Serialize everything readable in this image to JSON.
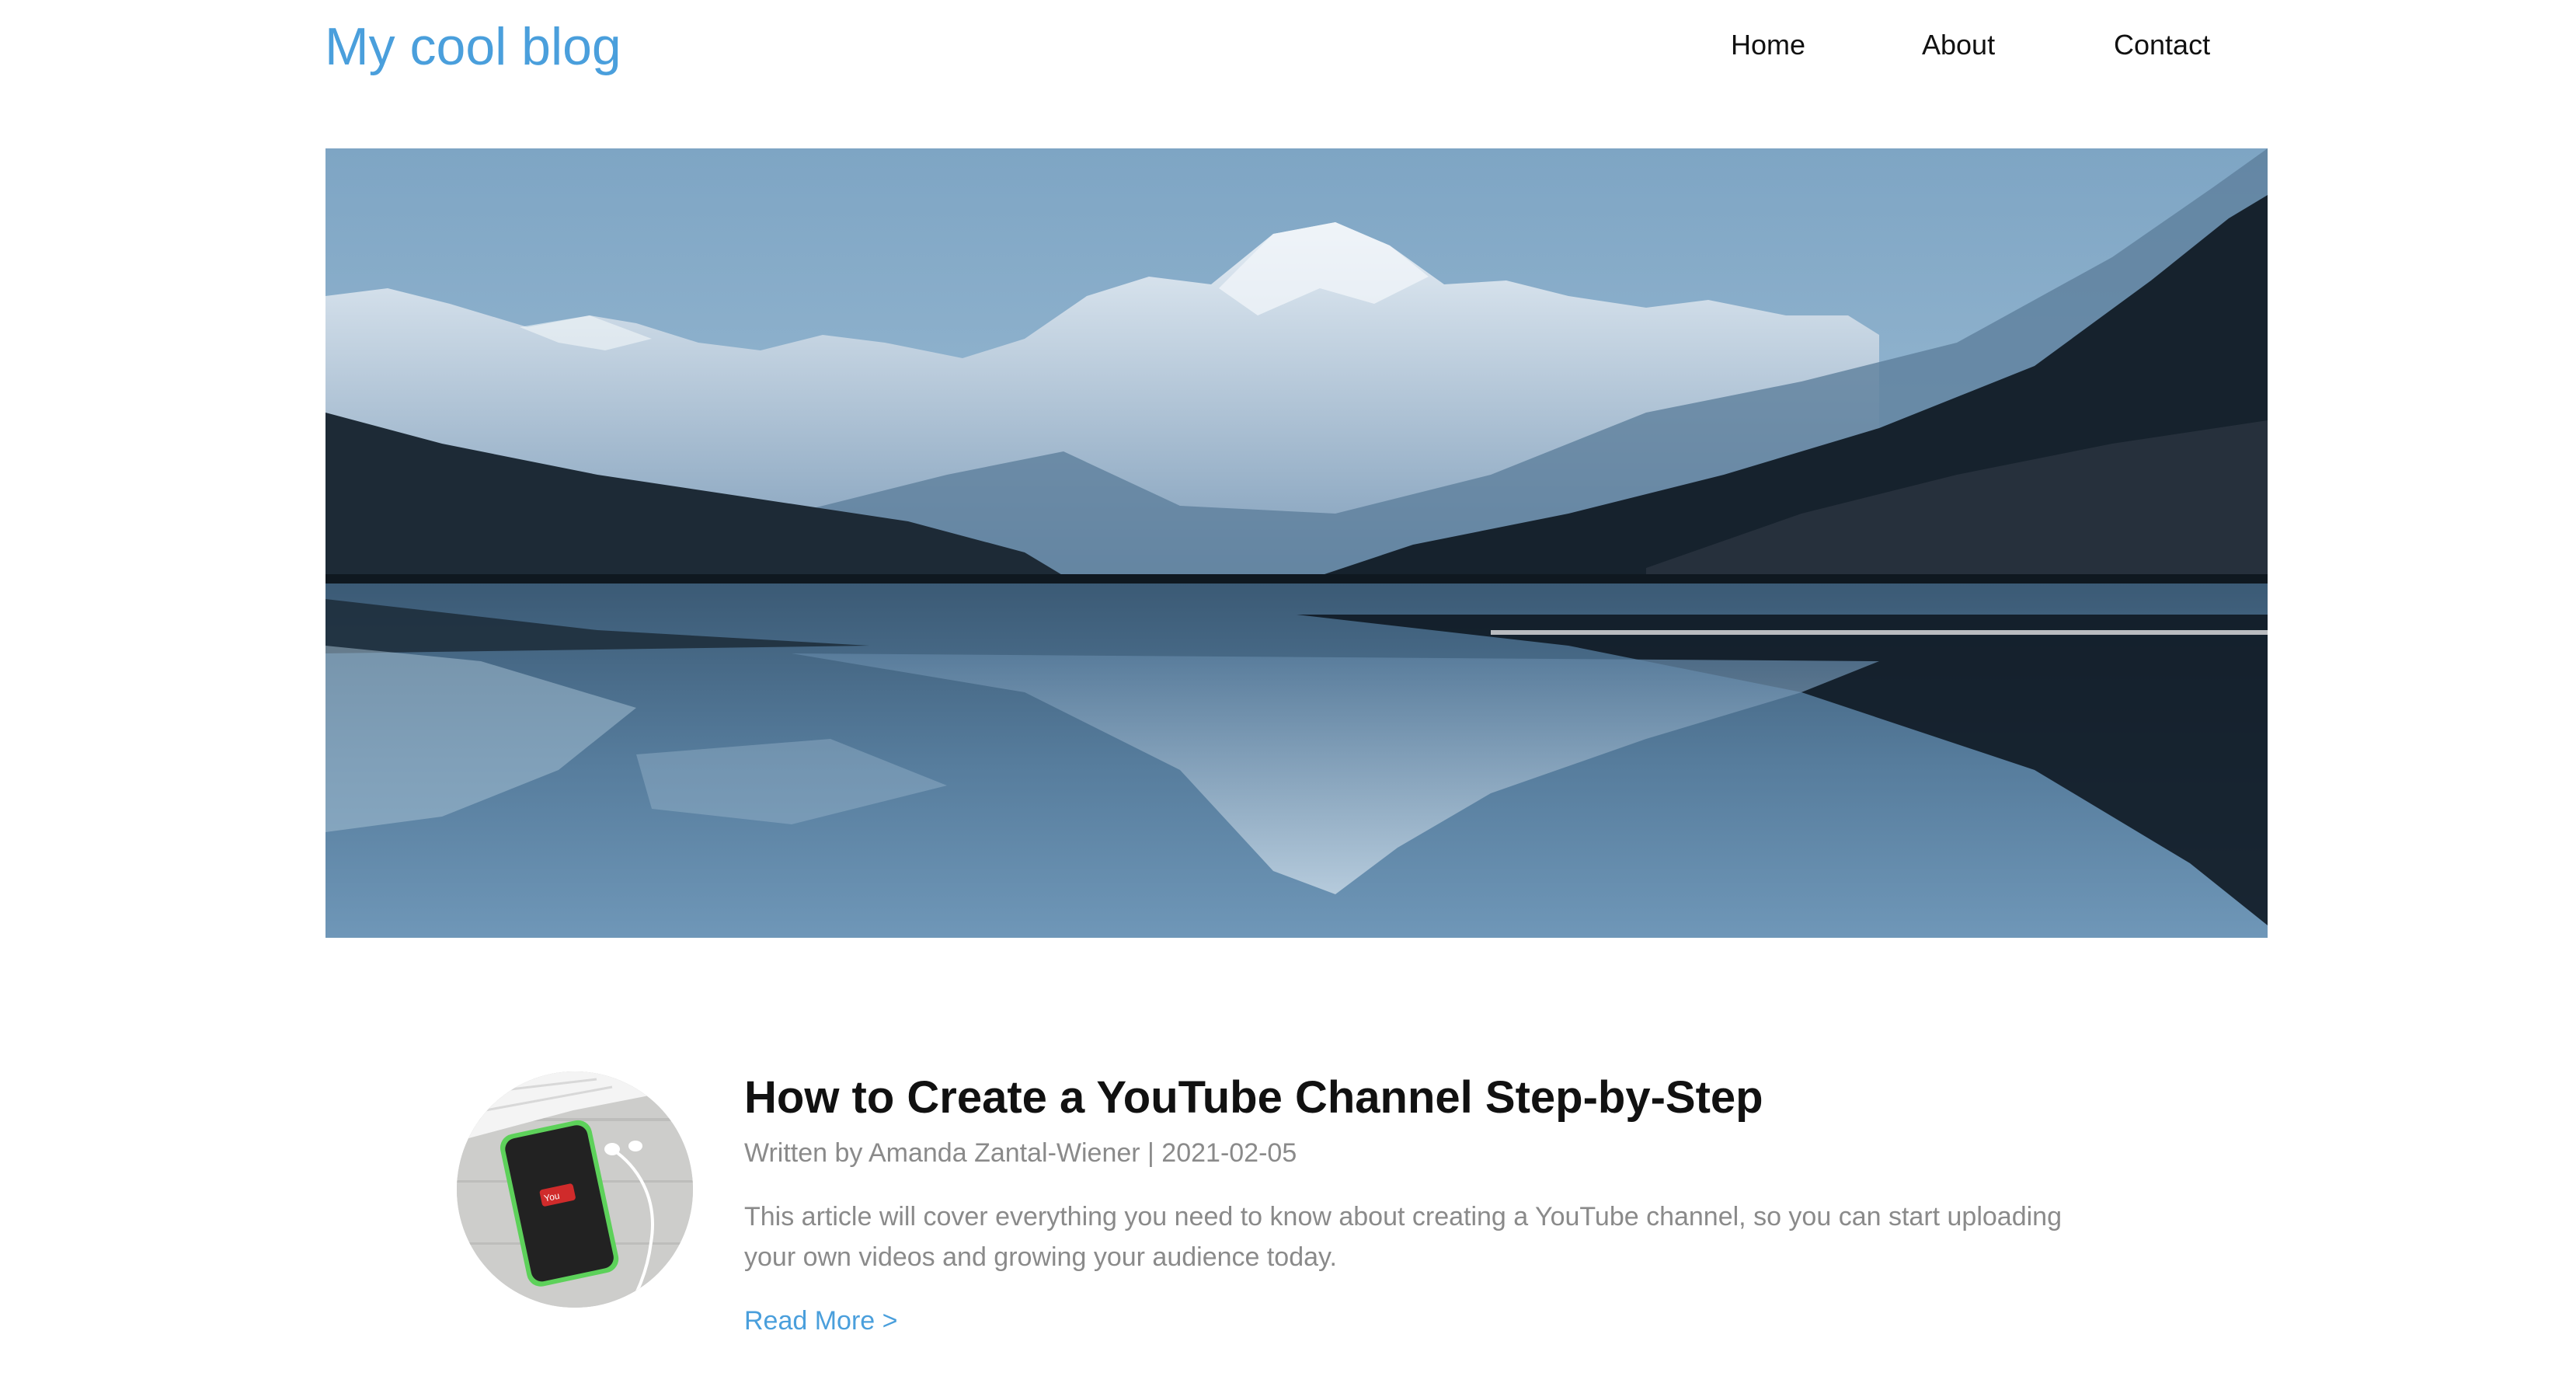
{
  "header": {
    "site_title": "My cool blog",
    "nav": {
      "home": "Home",
      "about": "About",
      "contact": "Contact"
    }
  },
  "hero": {
    "image_icon": "mountain-lake-image"
  },
  "post": {
    "thumbnail_icon": "phone-youtube-image",
    "title": "How to Create a YouTube Channel Step-by-Step",
    "meta": "Written by Amanda Zantal-Wiener | 2021-02-05",
    "excerpt": "This article will cover everything you need to know about creating a YouTube channel, so you can start uploading your own videos and growing your audience today.",
    "read_more": "Read More >"
  },
  "colors": {
    "accent": "#4a9fdc",
    "text": "#111111",
    "muted": "#8a8a8a",
    "background": "#ffffff"
  }
}
